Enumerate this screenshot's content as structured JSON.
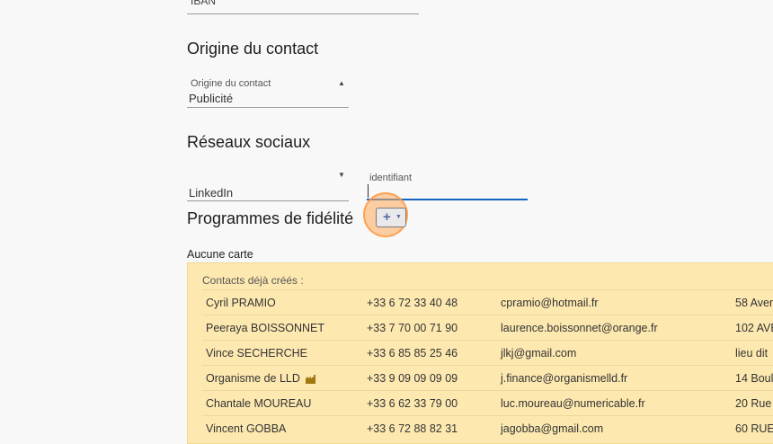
{
  "iban": {
    "label": "IBAN"
  },
  "origin": {
    "section_title": "Origine du contact",
    "field_label": "Origine du contact",
    "value": "Publicité"
  },
  "social": {
    "section_title": "Réseaux sociaux",
    "network_value": "LinkedIn",
    "identifier_label": "identifiant",
    "identifier_value": ""
  },
  "loyalty": {
    "section_title": "Programmes de fidélité",
    "add_button_label": "+",
    "empty_text": "Aucune carte"
  },
  "existing_contacts": {
    "heading": "Contacts déjà créés :",
    "rows": [
      {
        "name": "Cyril PRAMIO",
        "phone": "+33 6 72 33 40 48",
        "email": "cpramio@hotmail.fr",
        "address": "58 Aven"
      },
      {
        "name": "Peeraya BOISSONNET",
        "phone": "+33 7 70 00 71 90",
        "email": "laurence.boissonnet@orange.fr",
        "address": "102 AVE"
      },
      {
        "name": "Vince SECHERCHE",
        "phone": "+33 6 85 85 25 46",
        "email": "jlkj@gmail.com",
        "address": "lieu dit"
      },
      {
        "name": "Organisme de LLD",
        "phone": "+33 9 09 09 09 09",
        "email": "j.finance@organismelld.fr",
        "address": "14 Boul",
        "icon": "factory-icon"
      },
      {
        "name": "Chantale MOUREAU",
        "phone": "+33 6 62 33 79 00",
        "email": "luc.moureau@numericable.fr",
        "address": "20 Rue"
      },
      {
        "name": "Vincent GOBBA",
        "phone": "+33 6 72 88 82 31",
        "email": "jagobba@gmail.com",
        "address": "60 RUE"
      }
    ]
  },
  "colors": {
    "accent": "#1565c0",
    "card_bg": "#fde9b0",
    "cursor": "#ffaa5a"
  }
}
